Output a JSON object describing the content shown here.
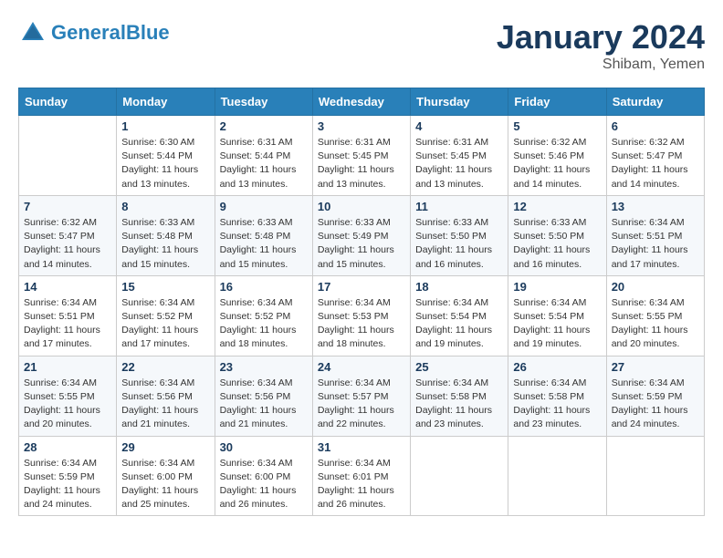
{
  "header": {
    "logo_line1": "General",
    "logo_line2": "Blue",
    "month": "January 2024",
    "location": "Shibam, Yemen"
  },
  "weekdays": [
    "Sunday",
    "Monday",
    "Tuesday",
    "Wednesday",
    "Thursday",
    "Friday",
    "Saturday"
  ],
  "weeks": [
    [
      {
        "num": "",
        "sunrise": "",
        "sunset": "",
        "daylight": ""
      },
      {
        "num": "1",
        "sunrise": "Sunrise: 6:30 AM",
        "sunset": "Sunset: 5:44 PM",
        "daylight": "Daylight: 11 hours and 13 minutes."
      },
      {
        "num": "2",
        "sunrise": "Sunrise: 6:31 AM",
        "sunset": "Sunset: 5:44 PM",
        "daylight": "Daylight: 11 hours and 13 minutes."
      },
      {
        "num": "3",
        "sunrise": "Sunrise: 6:31 AM",
        "sunset": "Sunset: 5:45 PM",
        "daylight": "Daylight: 11 hours and 13 minutes."
      },
      {
        "num": "4",
        "sunrise": "Sunrise: 6:31 AM",
        "sunset": "Sunset: 5:45 PM",
        "daylight": "Daylight: 11 hours and 13 minutes."
      },
      {
        "num": "5",
        "sunrise": "Sunrise: 6:32 AM",
        "sunset": "Sunset: 5:46 PM",
        "daylight": "Daylight: 11 hours and 14 minutes."
      },
      {
        "num": "6",
        "sunrise": "Sunrise: 6:32 AM",
        "sunset": "Sunset: 5:47 PM",
        "daylight": "Daylight: 11 hours and 14 minutes."
      }
    ],
    [
      {
        "num": "7",
        "sunrise": "Sunrise: 6:32 AM",
        "sunset": "Sunset: 5:47 PM",
        "daylight": "Daylight: 11 hours and 14 minutes."
      },
      {
        "num": "8",
        "sunrise": "Sunrise: 6:33 AM",
        "sunset": "Sunset: 5:48 PM",
        "daylight": "Daylight: 11 hours and 15 minutes."
      },
      {
        "num": "9",
        "sunrise": "Sunrise: 6:33 AM",
        "sunset": "Sunset: 5:48 PM",
        "daylight": "Daylight: 11 hours and 15 minutes."
      },
      {
        "num": "10",
        "sunrise": "Sunrise: 6:33 AM",
        "sunset": "Sunset: 5:49 PM",
        "daylight": "Daylight: 11 hours and 15 minutes."
      },
      {
        "num": "11",
        "sunrise": "Sunrise: 6:33 AM",
        "sunset": "Sunset: 5:50 PM",
        "daylight": "Daylight: 11 hours and 16 minutes."
      },
      {
        "num": "12",
        "sunrise": "Sunrise: 6:33 AM",
        "sunset": "Sunset: 5:50 PM",
        "daylight": "Daylight: 11 hours and 16 minutes."
      },
      {
        "num": "13",
        "sunrise": "Sunrise: 6:34 AM",
        "sunset": "Sunset: 5:51 PM",
        "daylight": "Daylight: 11 hours and 17 minutes."
      }
    ],
    [
      {
        "num": "14",
        "sunrise": "Sunrise: 6:34 AM",
        "sunset": "Sunset: 5:51 PM",
        "daylight": "Daylight: 11 hours and 17 minutes."
      },
      {
        "num": "15",
        "sunrise": "Sunrise: 6:34 AM",
        "sunset": "Sunset: 5:52 PM",
        "daylight": "Daylight: 11 hours and 17 minutes."
      },
      {
        "num": "16",
        "sunrise": "Sunrise: 6:34 AM",
        "sunset": "Sunset: 5:52 PM",
        "daylight": "Daylight: 11 hours and 18 minutes."
      },
      {
        "num": "17",
        "sunrise": "Sunrise: 6:34 AM",
        "sunset": "Sunset: 5:53 PM",
        "daylight": "Daylight: 11 hours and 18 minutes."
      },
      {
        "num": "18",
        "sunrise": "Sunrise: 6:34 AM",
        "sunset": "Sunset: 5:54 PM",
        "daylight": "Daylight: 11 hours and 19 minutes."
      },
      {
        "num": "19",
        "sunrise": "Sunrise: 6:34 AM",
        "sunset": "Sunset: 5:54 PM",
        "daylight": "Daylight: 11 hours and 19 minutes."
      },
      {
        "num": "20",
        "sunrise": "Sunrise: 6:34 AM",
        "sunset": "Sunset: 5:55 PM",
        "daylight": "Daylight: 11 hours and 20 minutes."
      }
    ],
    [
      {
        "num": "21",
        "sunrise": "Sunrise: 6:34 AM",
        "sunset": "Sunset: 5:55 PM",
        "daylight": "Daylight: 11 hours and 20 minutes."
      },
      {
        "num": "22",
        "sunrise": "Sunrise: 6:34 AM",
        "sunset": "Sunset: 5:56 PM",
        "daylight": "Daylight: 11 hours and 21 minutes."
      },
      {
        "num": "23",
        "sunrise": "Sunrise: 6:34 AM",
        "sunset": "Sunset: 5:56 PM",
        "daylight": "Daylight: 11 hours and 21 minutes."
      },
      {
        "num": "24",
        "sunrise": "Sunrise: 6:34 AM",
        "sunset": "Sunset: 5:57 PM",
        "daylight": "Daylight: 11 hours and 22 minutes."
      },
      {
        "num": "25",
        "sunrise": "Sunrise: 6:34 AM",
        "sunset": "Sunset: 5:58 PM",
        "daylight": "Daylight: 11 hours and 23 minutes."
      },
      {
        "num": "26",
        "sunrise": "Sunrise: 6:34 AM",
        "sunset": "Sunset: 5:58 PM",
        "daylight": "Daylight: 11 hours and 23 minutes."
      },
      {
        "num": "27",
        "sunrise": "Sunrise: 6:34 AM",
        "sunset": "Sunset: 5:59 PM",
        "daylight": "Daylight: 11 hours and 24 minutes."
      }
    ],
    [
      {
        "num": "28",
        "sunrise": "Sunrise: 6:34 AM",
        "sunset": "Sunset: 5:59 PM",
        "daylight": "Daylight: 11 hours and 24 minutes."
      },
      {
        "num": "29",
        "sunrise": "Sunrise: 6:34 AM",
        "sunset": "Sunset: 6:00 PM",
        "daylight": "Daylight: 11 hours and 25 minutes."
      },
      {
        "num": "30",
        "sunrise": "Sunrise: 6:34 AM",
        "sunset": "Sunset: 6:00 PM",
        "daylight": "Daylight: 11 hours and 26 minutes."
      },
      {
        "num": "31",
        "sunrise": "Sunrise: 6:34 AM",
        "sunset": "Sunset: 6:01 PM",
        "daylight": "Daylight: 11 hours and 26 minutes."
      },
      {
        "num": "",
        "sunrise": "",
        "sunset": "",
        "daylight": ""
      },
      {
        "num": "",
        "sunrise": "",
        "sunset": "",
        "daylight": ""
      },
      {
        "num": "",
        "sunrise": "",
        "sunset": "",
        "daylight": ""
      }
    ]
  ]
}
